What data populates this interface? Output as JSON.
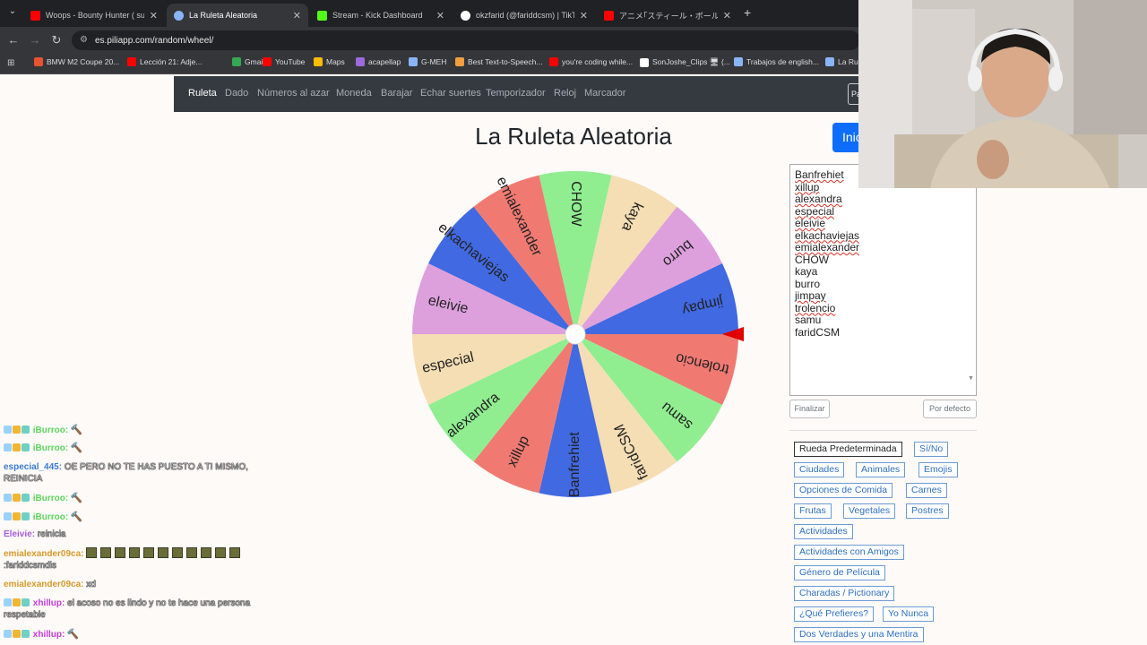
{
  "browser": {
    "tabs": [
      {
        "title": "Woops - Bounty Hunter ( super",
        "active": false,
        "favicon_color": "#ff0000"
      },
      {
        "title": "La Ruleta Aleatoria",
        "active": true,
        "favicon_color": "#8ab4f8"
      },
      {
        "title": "Stream - Kick Dashboard",
        "active": false,
        "favicon_color": "#53fc18"
      },
      {
        "title": "okzfarid (@fariddcsm) | TikTok",
        "active": false,
        "favicon_color": "#ffffff"
      },
      {
        "title": "アニメ｢スティール・ボール・ラン ジョジ",
        "active": false,
        "favicon_color": "#ff0000"
      }
    ],
    "url": "es.piliapp.com/random/wheel/",
    "bookmarks": [
      {
        "label": "BMW M2 Coupe 20...",
        "color": "#e8542f"
      },
      {
        "label": "Lección 21: Adje...",
        "color": "#ff0000"
      },
      {
        "label": "Gmail",
        "color": "#34a853"
      },
      {
        "label": "YouTube",
        "color": "#ff0000"
      },
      {
        "label": "Maps",
        "color": "#fbbc04"
      },
      {
        "label": "acapellap",
        "color": "#9c6ade"
      },
      {
        "label": "G-MEH",
        "color": "#8ab4f8"
      },
      {
        "label": "Best Text-to-Speech...",
        "color": "#f29f3d"
      },
      {
        "label": "you're coding while...",
        "color": "#ff0000"
      },
      {
        "label": "SonJoshe_Clips 🖥 (...",
        "color": "#ffffff"
      },
      {
        "label": "Trabajos de english...",
        "color": "#8ab4f8"
      },
      {
        "label": "La Rul",
        "color": "#8ab4f8"
      }
    ]
  },
  "site": {
    "nav": [
      "Ruleta",
      "Dado",
      "Números al azar",
      "Moneda",
      "Barajar",
      "Echar suertes",
      "Temporizador",
      "Reloj",
      "Marcador"
    ],
    "nav_box_text": "Pa",
    "title": "La Ruleta Aleatoria",
    "start_button": "Inic",
    "finish_button": "Finalizar",
    "default_button": "Por defecto",
    "presets": [
      "Rueda Predeterminada",
      "Sí/No",
      "Ciudades",
      "Animales",
      "Emojis",
      "Opciones de Comida",
      "Carnes",
      "Frutas",
      "Vegetales",
      "Postres",
      "Actividades",
      "Actividades con Amigos",
      "Género de Película",
      "Charadas / Pictionary",
      "¿Qué Prefieres?",
      "Yo Nunca",
      "Dos Verdades y una Mentira"
    ]
  },
  "names_list": [
    "Banfrehiet",
    "xillup",
    "alexandra",
    "especial",
    "eleivie",
    "elkachaviejas",
    "emialexander",
    "CHOW",
    "kaya",
    "burro",
    "jimpay",
    "trolencio",
    "samu",
    "faridCSM"
  ],
  "wheel": {
    "segments": [
      {
        "label": "CHOW",
        "color": "#90ee90"
      },
      {
        "label": "kaya",
        "color": "#f5deb3"
      },
      {
        "label": "burro",
        "color": "#dda0dd"
      },
      {
        "label": "jimpay",
        "color": "#4169e1"
      },
      {
        "label": "trolencio",
        "color": "#f07a72"
      },
      {
        "label": "samu",
        "color": "#90ee90"
      },
      {
        "label": "faridCSM",
        "color": "#f5deb3"
      },
      {
        "label": "Banfrehiet",
        "color": "#4169e1"
      },
      {
        "label": "xillup",
        "color": "#f07a72"
      },
      {
        "label": "alexandra",
        "color": "#90ee90"
      },
      {
        "label": "especial",
        "color": "#f5deb3"
      },
      {
        "label": "eleivie",
        "color": "#dda0dd"
      },
      {
        "label": "elkachaviejas",
        "color": "#4169e1"
      },
      {
        "label": "emialexander",
        "color": "#f07a72"
      }
    ],
    "pointer_color": "#e00000"
  },
  "chat": [
    {
      "user": "iBurroo:",
      "text": "🔨",
      "color": "#5cd65c"
    },
    {
      "user": "iBurroo:",
      "text": "🔨",
      "color": "#5cd65c"
    },
    {
      "user": "especial_445:",
      "text": "OE PERO NO TE HAS PUESTO A TI MISMO,",
      "color": "#3b7bd1",
      "text2": "REINICIA"
    },
    {
      "user": "iBurroo:",
      "text": "🔨",
      "color": "#5cd65c"
    },
    {
      "user": "iBurroo:",
      "text": "🔨",
      "color": "#5cd65c"
    },
    {
      "user": "Eleivie:",
      "text": "reinicia",
      "color": "#a65cd6"
    },
    {
      "user": "emialexander09ca:",
      "text": "",
      "color": "#d69a2a",
      "text2": ":fariddcsmdis"
    },
    {
      "user": "emialexander09ca:",
      "text": "xd",
      "color": "#d69a2a"
    },
    {
      "user": "xhillup:",
      "text": "el acoso no es lindo y no te hace una persona",
      "color": "#c23bd6",
      "text2": "respetable"
    },
    {
      "user": "xhillup:",
      "text": "🔨",
      "color": "#c23bd6"
    }
  ]
}
